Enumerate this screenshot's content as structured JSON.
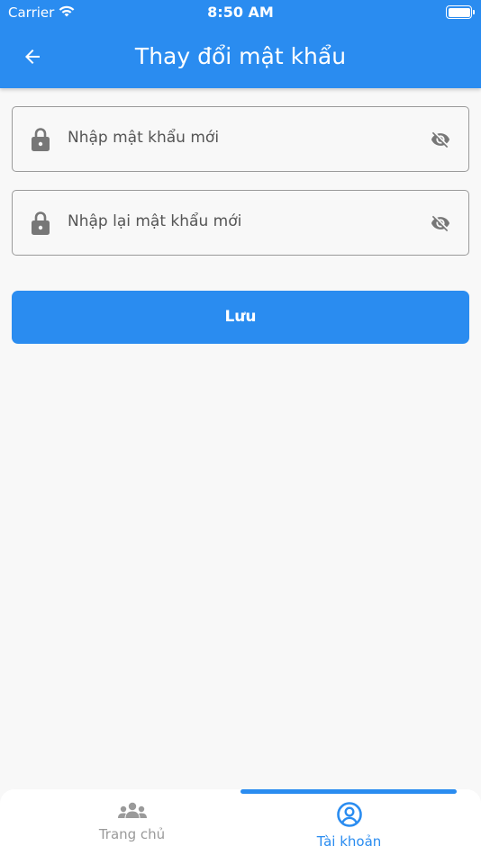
{
  "status_bar": {
    "carrier": "Carrier",
    "time": "8:50 AM"
  },
  "header": {
    "title": "Thay đổi mật khẩu",
    "back_icon": "arrow-left-icon"
  },
  "form": {
    "new_password_placeholder": "Nhập mật khẩu mới",
    "confirm_password_placeholder": "Nhập lại mật khẩu mới",
    "save_label": "Lưu"
  },
  "tabs": {
    "home_label": "Trang chủ",
    "account_label": "Tài khoản",
    "active": "account"
  },
  "colors": {
    "primary": "#2a8cf0",
    "inactive": "#9a9a9a",
    "icon_gray": "#777777"
  }
}
